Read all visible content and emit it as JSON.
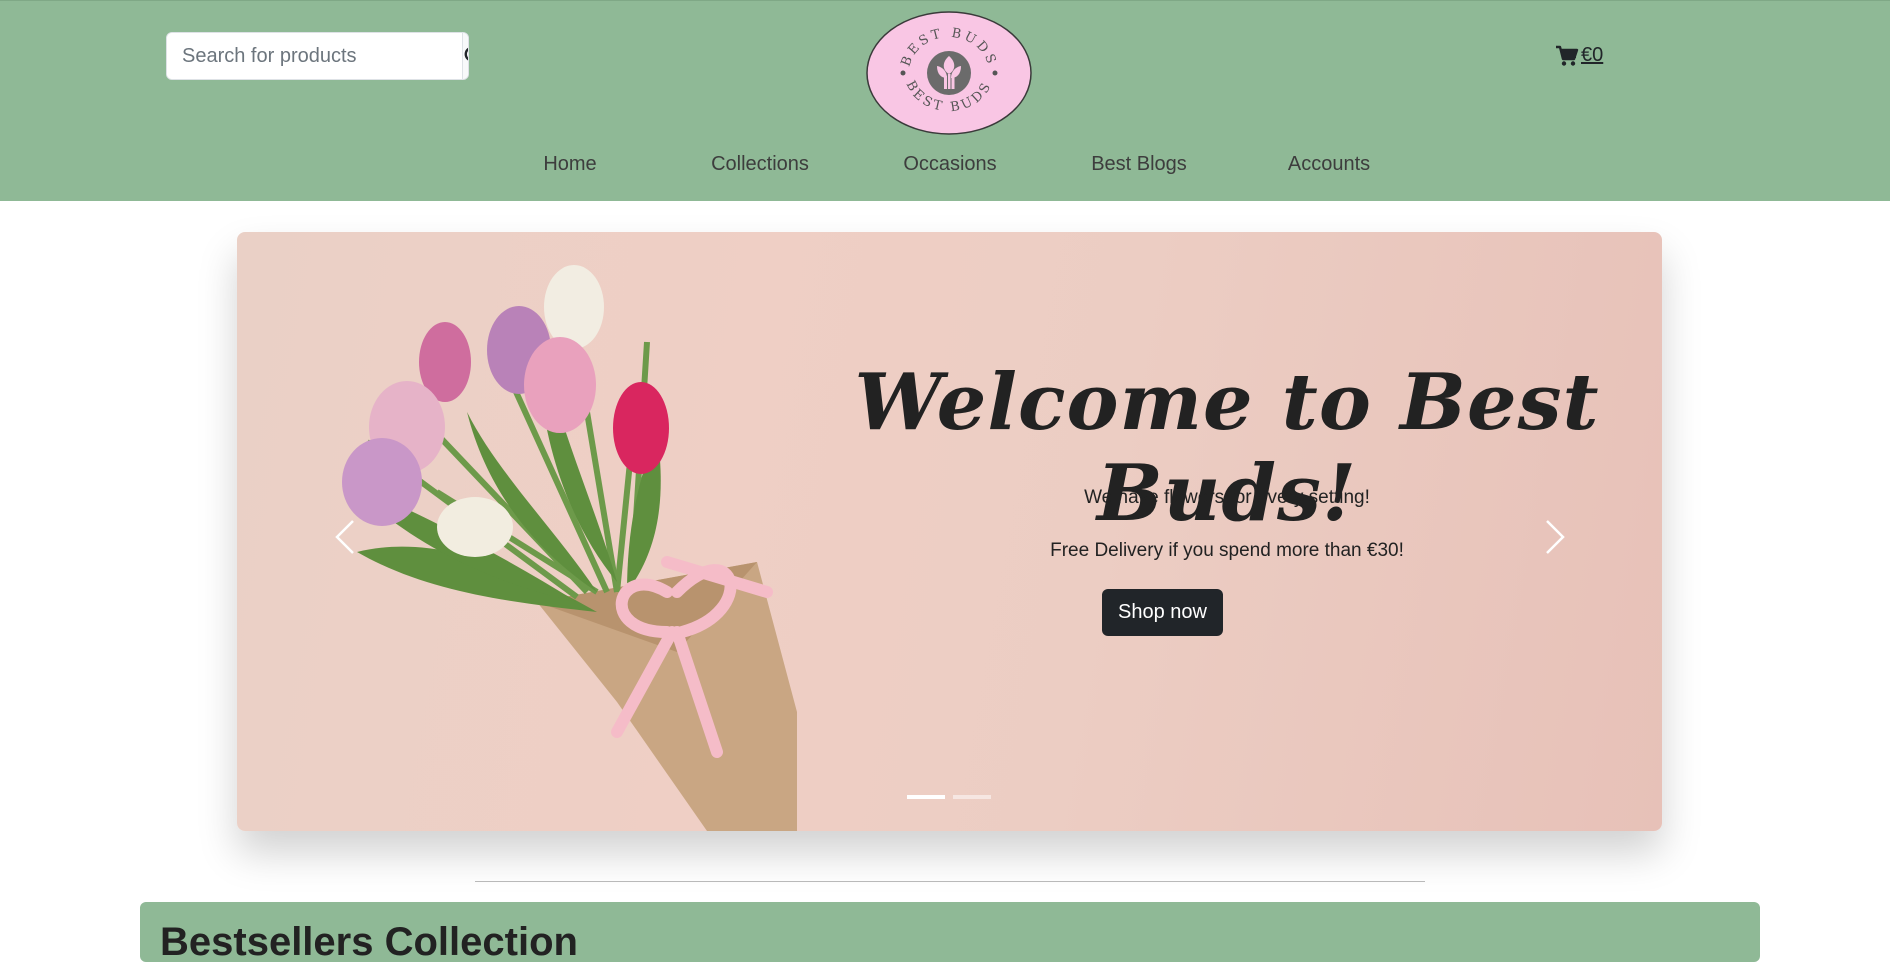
{
  "header": {
    "search": {
      "placeholder": "Search for products",
      "value": ""
    },
    "logo": {
      "top_text": "BEST BUDS",
      "bottom_text": "BEST BUDS"
    },
    "cart": {
      "label": " €0",
      "icon": "cart-icon"
    }
  },
  "nav": {
    "items": [
      {
        "label": "Home"
      },
      {
        "label": "Collections"
      },
      {
        "label": "Occasions"
      },
      {
        "label": "Best Blogs"
      },
      {
        "label": "Accounts"
      }
    ]
  },
  "hero": {
    "title": "Welcome to Best Buds!",
    "line1": "We have flowers for every setting!",
    "line2": "Free Delivery if you spend more than €30!",
    "button": "Shop now",
    "active_slide": 1,
    "slide_count": 2
  },
  "section": {
    "title": "Bestsellers Collection"
  },
  "colors": {
    "header_bg": "#8fb996",
    "logo_bg": "#f9c6e4",
    "button_bg": "#212529",
    "hero_bg": "#ecccc2"
  }
}
